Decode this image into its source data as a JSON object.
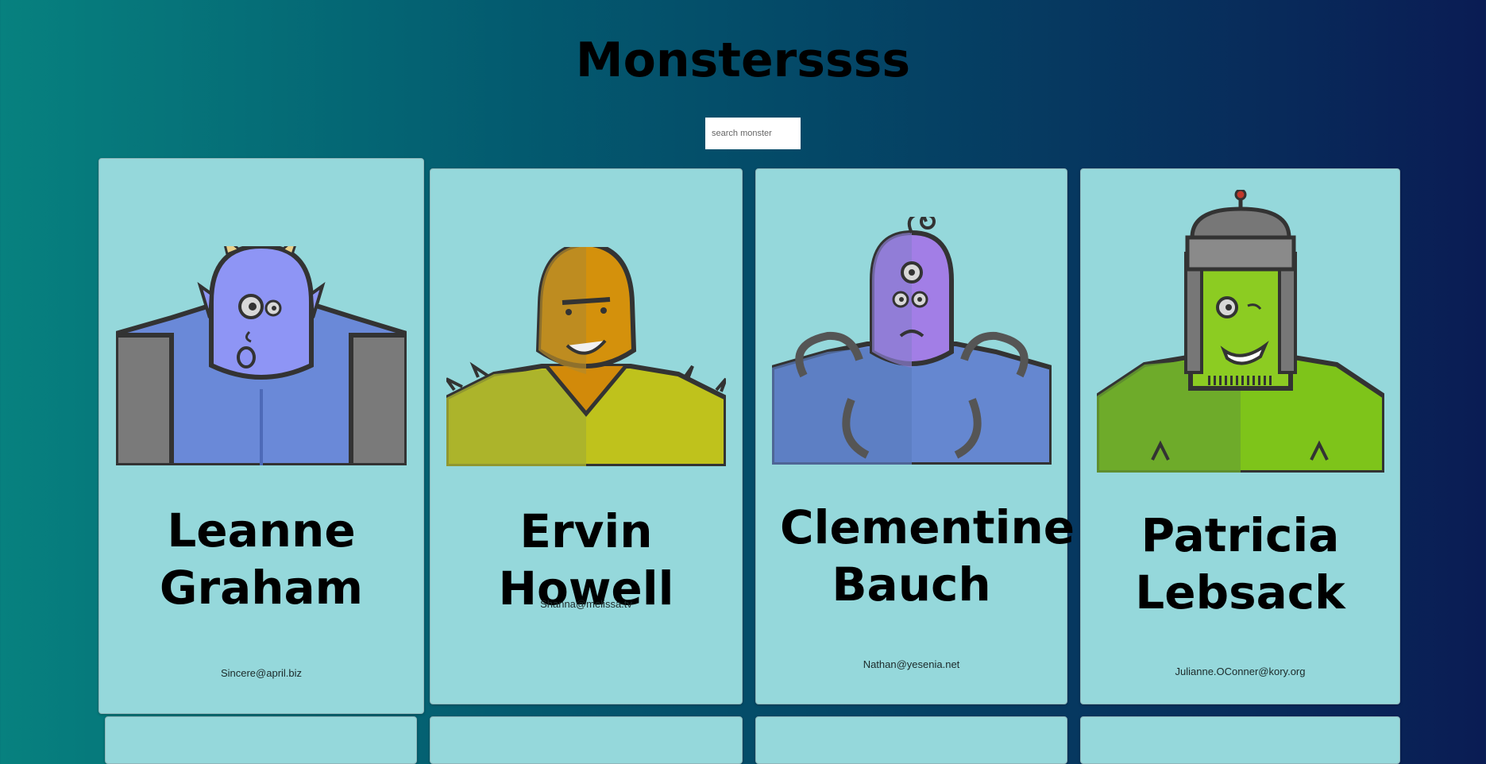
{
  "page": {
    "title": "Monsterssss"
  },
  "search": {
    "placeholder": "search monster",
    "value": ""
  },
  "monsters": [
    {
      "name": "Leanne Graham",
      "email": "Sincere@april.biz",
      "avatar": "blue-horned-monster"
    },
    {
      "name": "Ervin Howell",
      "email": "Shanna@melissa.tv",
      "avatar": "orange-spiky-monster"
    },
    {
      "name": "Clementine Bauch",
      "email": "Nathan@yesenia.net",
      "avatar": "purple-cyclops-robot-monster"
    },
    {
      "name": "Patricia Lebsack",
      "email": "Julianne.OConner@kory.org",
      "avatar": "green-helmet-monster"
    }
  ],
  "colors": {
    "card": "#95d8db",
    "gradient_start": "#07817f",
    "gradient_end": "#0a1c54"
  }
}
